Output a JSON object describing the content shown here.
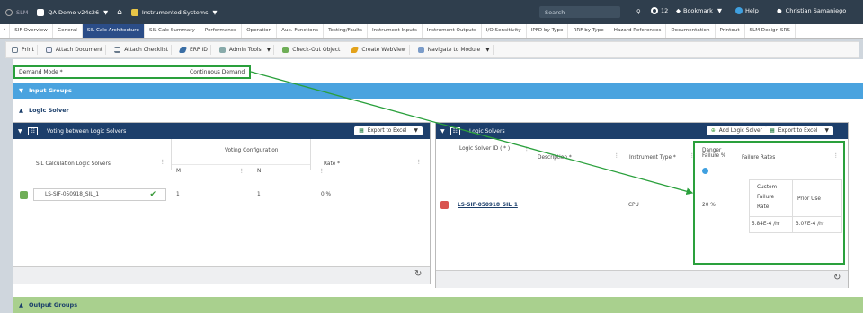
{
  "topbar": {
    "slm": "SLM",
    "project": "QA Demo v24s26",
    "home": "Instrumented Systems",
    "search": "Search",
    "notifications": "12",
    "bookmark": "Bookmark",
    "help": "Help",
    "user": "Christian Samaniego"
  },
  "tabs": [
    "SIF Overview",
    "General",
    "SIL Calc Architecture",
    "SIL Calc Summary",
    "Performance",
    "Operation",
    "Aux. Functions",
    "Testing/Faults",
    "Instrument Inputs",
    "Instrument Outputs",
    "I/O Sensitivity",
    "IPFD by Type",
    "RRF by Type",
    "Hazard References",
    "Documentation",
    "Printout",
    "SLM Design SRS"
  ],
  "active_tab": "SIL Calc Architecture",
  "toolbar": {
    "print": "Print",
    "attach_doc": "Attach Document",
    "attach_checklist": "Attach Checklist",
    "erp": "ERP ID",
    "admin": "Admin Tools",
    "checkout": "Check-Out Object",
    "webview": "Create WebView",
    "navigate": "Navigate to Module"
  },
  "demand": {
    "label": "Demand Mode *",
    "value": "Continuous Demand"
  },
  "sections": {
    "input": "Input Groups",
    "logic": "Logic Solver",
    "output": "Output Groups"
  },
  "voting": {
    "title": "Voting between Logic Solvers",
    "export": "Export to Excel",
    "col1": "SIL Calculation Logic Solvers",
    "col_group": "Voting Configuration",
    "m": "M",
    "n": "N",
    "rate": "Rate *",
    "row": {
      "name": "LS-SIF-050918_SIL_1",
      "m": "1",
      "n": "1",
      "rate": "0 %"
    }
  },
  "solvers": {
    "title": "Logic Solvers",
    "add": "Add Logic Solver",
    "export": "Export to Excel",
    "col_id": "Logic Solver ID ( * )",
    "col_desc": "Description *",
    "col_type": "Instrument Type *",
    "col_danger": "Danger Failure %",
    "col_rates": "Failure Rates",
    "row": {
      "id": "LS-SIF-050918_SIL_1",
      "type": "CPU",
      "danger": "20 %"
    },
    "rates": {
      "custom": "Custom Failure Rate",
      "prior": "Prior Use",
      "v1": "5.84E-4 /hr",
      "v2": "3.07E-4 /hr"
    }
  },
  "colors": {
    "nav": "#2f3e4d",
    "tab_active": "#2b4d88",
    "panel_head": "#1d3f6b",
    "input_bar": "#4aa3df",
    "output_bar": "#a9d08e",
    "highlight": "#2aa03c"
  }
}
